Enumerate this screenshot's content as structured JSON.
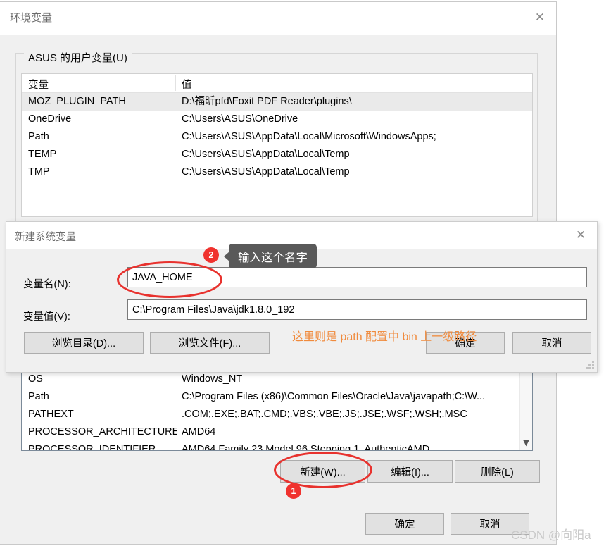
{
  "env_window": {
    "title": "环境变量",
    "close_icon": "close-icon",
    "group_label": "ASUS 的用户变量(U)",
    "table": {
      "headers": {
        "variable": "变量",
        "value": "值"
      },
      "rows": [
        {
          "variable": "MOZ_PLUGIN_PATH",
          "value": "D:\\福昕pfd\\Foxit PDF Reader\\plugins\\",
          "selected": true
        },
        {
          "variable": "OneDrive",
          "value": "C:\\Users\\ASUS\\OneDrive",
          "selected": false
        },
        {
          "variable": "Path",
          "value": "C:\\Users\\ASUS\\AppData\\Local\\Microsoft\\WindowsApps;",
          "selected": false
        },
        {
          "variable": "TEMP",
          "value": "C:\\Users\\ASUS\\AppData\\Local\\Temp",
          "selected": false
        },
        {
          "variable": "TMP",
          "value": "C:\\Users\\ASUS\\AppData\\Local\\Temp",
          "selected": false
        }
      ]
    },
    "system_table": {
      "rows": [
        {
          "variable": "OS",
          "value": "Windows_NT"
        },
        {
          "variable": "Path",
          "value": "C:\\Program Files (x86)\\Common Files\\Oracle\\Java\\javapath;C:\\W..."
        },
        {
          "variable": "PATHEXT",
          "value": ".COM;.EXE;.BAT;.CMD;.VBS;.VBE;.JS;.JSE;.WSF;.WSH;.MSC"
        },
        {
          "variable": "PROCESSOR_ARCHITECTURE",
          "value": "AMD64"
        },
        {
          "variable": "PROCESSOR_IDENTIFIER",
          "value": "AMD64 Family 23 Model 96 Stepping 1, AuthenticAMD"
        }
      ],
      "scroll_down_icon": "chevron-down-icon"
    },
    "buttons": {
      "new": "新建(W)...",
      "edit": "编辑(I)...",
      "delete": "删除(L)",
      "ok": "确定",
      "cancel": "取消"
    }
  },
  "newvar_dialog": {
    "title": "新建系统变量",
    "close_icon": "close-icon",
    "name_label": "变量名(N):",
    "name_value": "JAVA_HOME",
    "value_label": "变量值(V):",
    "value_value": "C:\\Program Files\\Java\\jdk1.8.0_192",
    "buttons": {
      "browse_dir": "浏览目录(D)...",
      "browse_file": "浏览文件(F)...",
      "ok": "确定",
      "cancel": "取消"
    }
  },
  "annotations": {
    "badge_1": "1",
    "badge_2": "2",
    "tooltip_name": "输入这个名字",
    "orange_note": "这里则是 path 配置中 bin 上一级路径",
    "ellipse_color": "#e8322e",
    "badge_color": "#f0322e",
    "tooltip_bg": "#595959",
    "orange_color": "#f08a3c"
  },
  "watermark": "CSDN @向阳a"
}
